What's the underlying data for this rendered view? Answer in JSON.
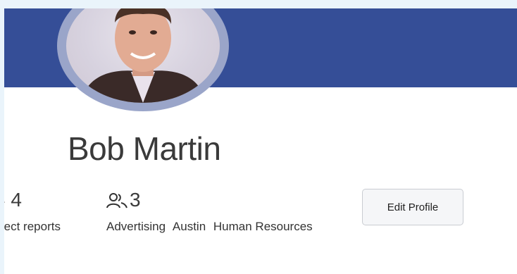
{
  "profile": {
    "name": "Bob Martin",
    "direct_reports": {
      "count": "4",
      "label": "rect reports"
    },
    "members": {
      "count": "3"
    },
    "tags": [
      "Advertising",
      "Austin",
      "Human Resources"
    ],
    "edit_button_label": "Edit Profile"
  },
  "icons": {
    "people": "people-icon",
    "org": "org-chart-icon"
  },
  "colors": {
    "banner": "#354e97",
    "avatar_ring": "#9aa5c9",
    "page_bg": "#eaf4fb"
  }
}
